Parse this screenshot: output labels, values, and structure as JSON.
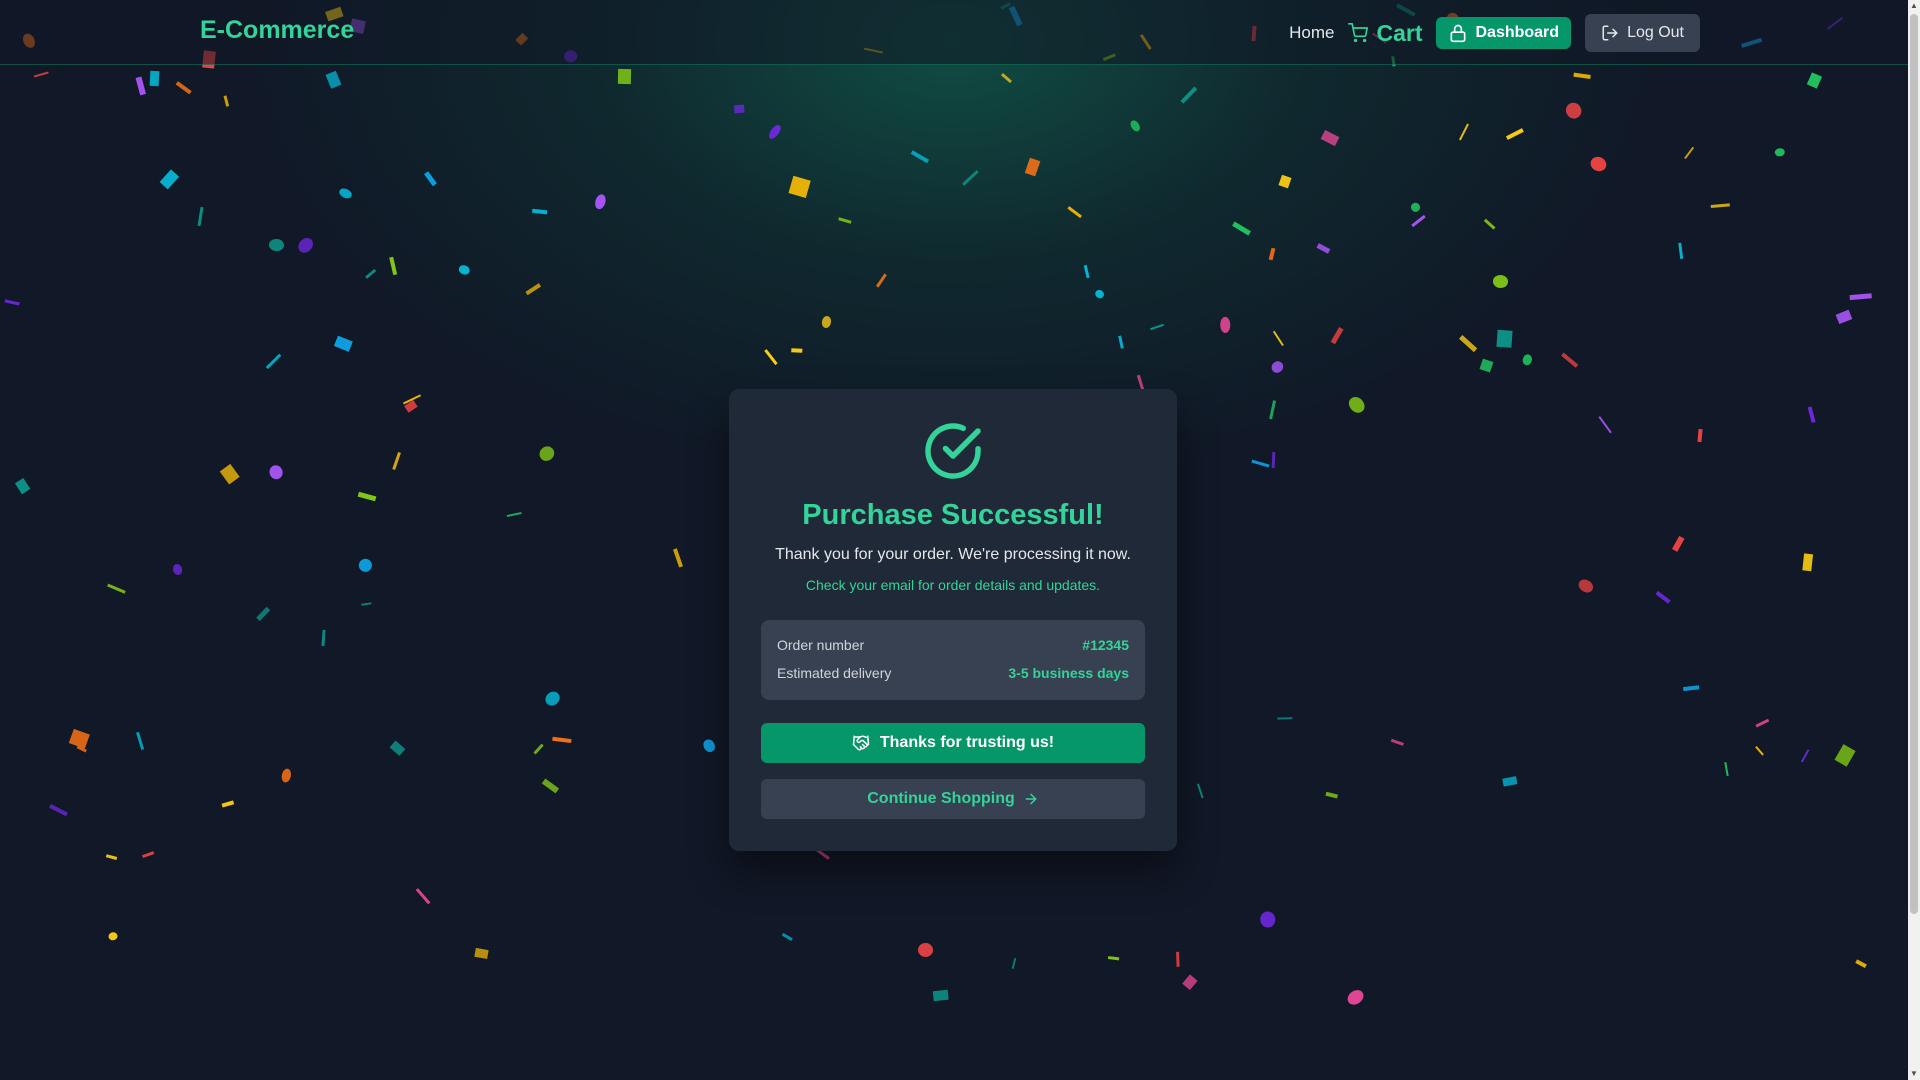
{
  "navbar": {
    "brand": "E-Commerce",
    "home_label": "Home",
    "cart_label": "Cart",
    "dashboard_label": "Dashboard",
    "logout_label": "Log Out"
  },
  "success": {
    "title": "Purchase Successful!",
    "subtitle": "Thank you for your order. We're processing it now.",
    "note": "Check your email for order details and updates.",
    "order_number_label": "Order number",
    "order_number_value": "#12345",
    "delivery_label": "Estimated delivery",
    "delivery_value": "3-5 business days",
    "thanks_button": "Thanks for trusting us!",
    "continue_button": "Continue Shopping"
  },
  "colors": {
    "accent": "#34d399",
    "button_primary": "#059669",
    "card_bg": "#1f2937",
    "page_bg": "#111827"
  },
  "icons": {
    "check": "check-circle-icon",
    "cart": "shopping-cart-icon",
    "dashboard": "lock-icon",
    "logout": "logout-icon",
    "thanks": "handshake-icon",
    "continue": "arrow-right-icon"
  }
}
